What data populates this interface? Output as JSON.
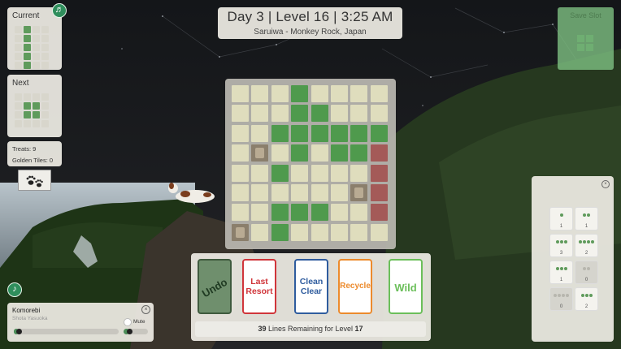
{
  "header": {
    "title": "Day 3 | Level 16 | 3:25 AM",
    "location": "Saruiwa - Monkey Rock, Japan"
  },
  "current_piece": {
    "label": "Current",
    "cells": [
      [
        0,
        1,
        0,
        0
      ],
      [
        0,
        1,
        0,
        0
      ],
      [
        0,
        1,
        0,
        0
      ],
      [
        0,
        1,
        0,
        0
      ],
      [
        0,
        1,
        0,
        0
      ]
    ]
  },
  "next_piece": {
    "label": "Next",
    "cells": [
      [
        0,
        0,
        0,
        0
      ],
      [
        0,
        1,
        1,
        0
      ],
      [
        0,
        1,
        1,
        0
      ],
      [
        0,
        0,
        0,
        0
      ]
    ]
  },
  "stats": {
    "treats": "Treats: 9",
    "golden_tiles": "Golden Tiles: 0"
  },
  "save_slot": {
    "label": "Save Slot"
  },
  "board": {
    "rows": [
      "...g....",
      "...gg...",
      "..gggggg",
      ".s.g.ggr",
      "..g....r",
      "......sr",
      "..ggg..r",
      "s.g....."
    ]
  },
  "cards": [
    {
      "name": "Undo",
      "color": "#4f7f4e"
    },
    {
      "name": "Last Resort",
      "color": "#d0353a"
    },
    {
      "name": "Clean Clear",
      "color": "#2f5c9e"
    },
    {
      "name": "Recycle",
      "color": "#ec8a2c"
    },
    {
      "name": "Wild",
      "color": "#6bbf5a"
    }
  ],
  "lines_status": {
    "count": "39",
    "middle": "Lines Remaining for Level",
    "level": "17"
  },
  "music": {
    "track": "Komorebi",
    "artist": "Shota Yasuoka",
    "mute_label": "Mute",
    "progress": 0.05,
    "volume": 0.22
  },
  "inventory": {
    "items": [
      {
        "dots": 1,
        "count": "1",
        "available": true
      },
      {
        "dots": 2,
        "count": "1",
        "available": true
      },
      {
        "dots": 3,
        "count": "3",
        "available": true
      },
      {
        "dots": 4,
        "count": "2",
        "available": true
      },
      {
        "dots": 3,
        "count": "1",
        "available": true
      },
      {
        "dots": 2,
        "count": "0",
        "available": false
      },
      {
        "dots": 4,
        "count": "0",
        "available": false
      },
      {
        "dots": 3,
        "count": "2",
        "available": true
      }
    ]
  },
  "colors": {
    "tile_green": "#4f9a4d",
    "tile_red": "#a45a58",
    "tile_empty": "#dfddbd",
    "accent": "#2f8e5c"
  }
}
